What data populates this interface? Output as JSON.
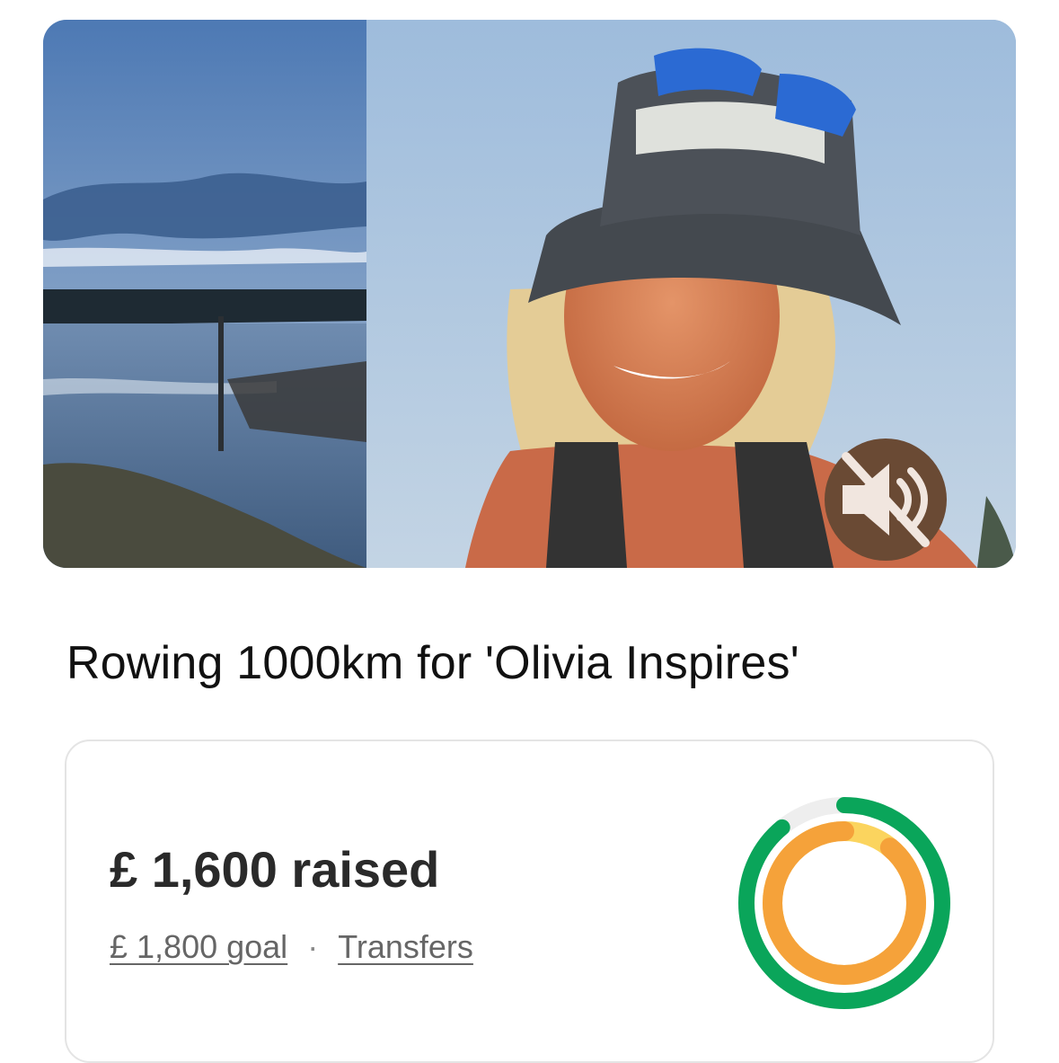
{
  "fundraiser": {
    "title": "Rowing 1000km for 'Olivia Inspires'",
    "raised_label": "£ 1,600 raised",
    "goal_label": "£ 1,800 goal",
    "separator": "·",
    "transfers_label": "Transfers",
    "progress_fraction": 0.89
  },
  "media": {
    "mute_icon": "speaker-muted-icon"
  },
  "colors": {
    "ring_green": "#0aa55a",
    "ring_orange": "#f5a23a",
    "ring_yellow": "#fbd45e",
    "ring_track": "#eeeeee",
    "mute_bg": "#6a4a34"
  }
}
